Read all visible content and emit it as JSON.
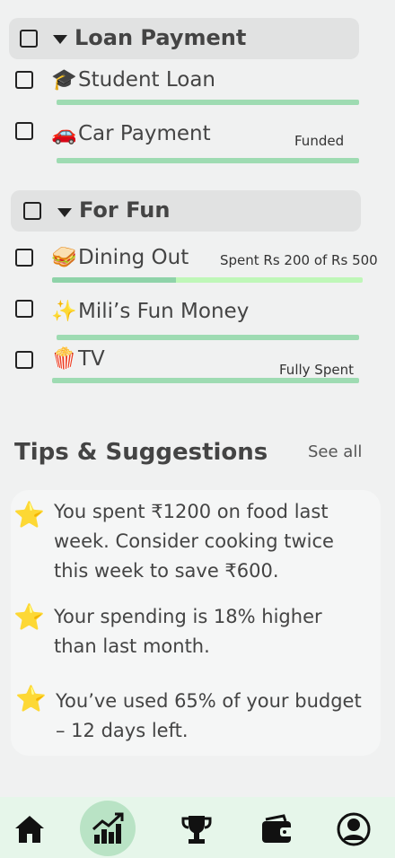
{
  "groups": [
    {
      "title": "Loan Payment",
      "items": [
        {
          "emoji": "🎓",
          "label": "Student Loan",
          "status": ""
        },
        {
          "emoji": "🚗",
          "label": "Car Payment",
          "status": "Funded"
        }
      ]
    },
    {
      "title": "For Fun",
      "items": [
        {
          "emoji": "🥪",
          "label": "Dining Out",
          "status": "Spent Rs 200 of Rs 500",
          "progress": 0.4
        },
        {
          "emoji": "✨",
          "label": "Mili’s Fun Money",
          "status": ""
        },
        {
          "emoji": "🍿",
          "label": "TV",
          "status": "Fully Spent"
        }
      ]
    }
  ],
  "tips": {
    "title": "Tips & Suggestions",
    "see_all": "See all",
    "items": [
      {
        "icon": "star-icon",
        "text": "You spent ₹1200 on food last week. Consider cooking twice this week to save ₹600."
      },
      {
        "icon": "star-icon",
        "text": "Your spending is 18% higher than last month."
      },
      {
        "icon": "star-icon",
        "text": "You’ve used 65% of your budget – 12 days left."
      }
    ]
  },
  "nav": {
    "items": [
      "home-icon",
      "chart-icon",
      "trophy-icon",
      "wallet-icon",
      "profile-icon"
    ],
    "active": "chart-icon"
  },
  "colors": {
    "bar": "#9edbb2",
    "bar_light": "#bff7b8",
    "nav_bg": "#e6f6ea",
    "nav_active": "#b9e3c5",
    "star": "#f4c430"
  }
}
